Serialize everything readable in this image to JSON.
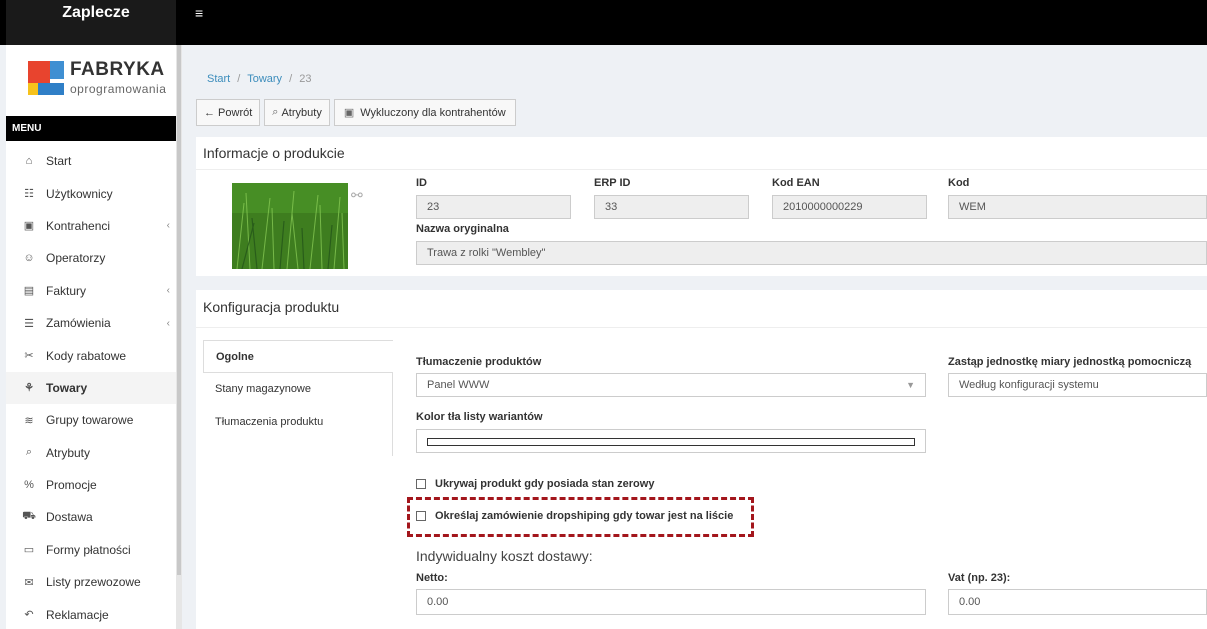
{
  "topbar": {
    "brand": "Zaplecze",
    "menu_toggle": "≡"
  },
  "logo": {
    "name": "FABRYKA",
    "sub": "oprogramowania"
  },
  "sidebar": {
    "menu_label": "MENU",
    "items": [
      {
        "label": "Start",
        "icon": "home-icon",
        "glyph": "⌂"
      },
      {
        "label": "Użytkownicy",
        "icon": "users-icon",
        "glyph": "☷"
      },
      {
        "label": "Kontrahenci",
        "icon": "contacts-icon",
        "glyph": "▣",
        "chevron": "‹"
      },
      {
        "label": "Operatorzy",
        "icon": "operators-icon",
        "glyph": "☺"
      },
      {
        "label": "Faktury",
        "icon": "invoice-icon",
        "glyph": "▤",
        "chevron": "‹"
      },
      {
        "label": "Zamówienia",
        "icon": "list-icon",
        "glyph": "☰",
        "chevron": "‹"
      },
      {
        "label": "Kody rabatowe",
        "icon": "scissors-icon",
        "glyph": "✂"
      },
      {
        "label": "Towary",
        "icon": "products-icon",
        "glyph": "⚘",
        "active": true
      },
      {
        "label": "Grupy towarowe",
        "icon": "layers-icon",
        "glyph": "≋"
      },
      {
        "label": "Atrybuty",
        "icon": "tag-icon",
        "glyph": "⌕"
      },
      {
        "label": "Promocje",
        "icon": "percent-icon",
        "glyph": "%"
      },
      {
        "label": "Dostawa",
        "icon": "truck-icon",
        "glyph": "⛟"
      },
      {
        "label": "Formy płatności",
        "icon": "payment-icon",
        "glyph": "▭"
      },
      {
        "label": "Listy przewozowe",
        "icon": "mail-icon",
        "glyph": "✉"
      },
      {
        "label": "Reklamacje",
        "icon": "return-icon",
        "glyph": "↶"
      }
    ]
  },
  "breadcrumb": {
    "start": "Start",
    "sep": "/",
    "towary": "Towary",
    "current": "23"
  },
  "toolbar": {
    "back": "← Powrót",
    "attrs_icon": "⌕",
    "attrs": "Atrybuty",
    "excluded_icon": "▣",
    "excluded": "Wykluczony dla kontrahentów"
  },
  "product_info": {
    "title": "Informacje o produkcie",
    "link_icon": "⚯",
    "id_label": "ID",
    "id_value": "23",
    "erp_label": "ERP ID",
    "erp_value": "33",
    "ean_label": "Kod EAN",
    "ean_value": "2010000000229",
    "kod_label": "Kod",
    "kod_value": "WEM",
    "orig_label": "Nazwa oryginalna",
    "orig_value": "Trawa z rolki \"Wembley\""
  },
  "config": {
    "title": "Konfiguracja produktu",
    "tabs": [
      "Ogolne",
      "Stany magazynowe",
      "Tłumaczenia produktu"
    ],
    "translation_label": "Tłumaczenie produktów",
    "translation_value": "Panel WWW",
    "select_arrow": "▼",
    "unit_label": "Zastąp jednostkę miary jednostką pomocniczą",
    "unit_value": "Według konfiguracji systemu",
    "color_label": "Kolor tła listy wariantów",
    "hide_zero": "Ukrywaj produkt gdy posiada stan zerowy",
    "dropship": "Określaj zamówienie dropshiping gdy towar jest na liście",
    "shipping_title": "Indywidualny koszt dostawy:",
    "netto_label": "Netto:",
    "netto_value": "0.00",
    "vat_label": "Vat (np. 23):",
    "vat_value": "0.00"
  }
}
